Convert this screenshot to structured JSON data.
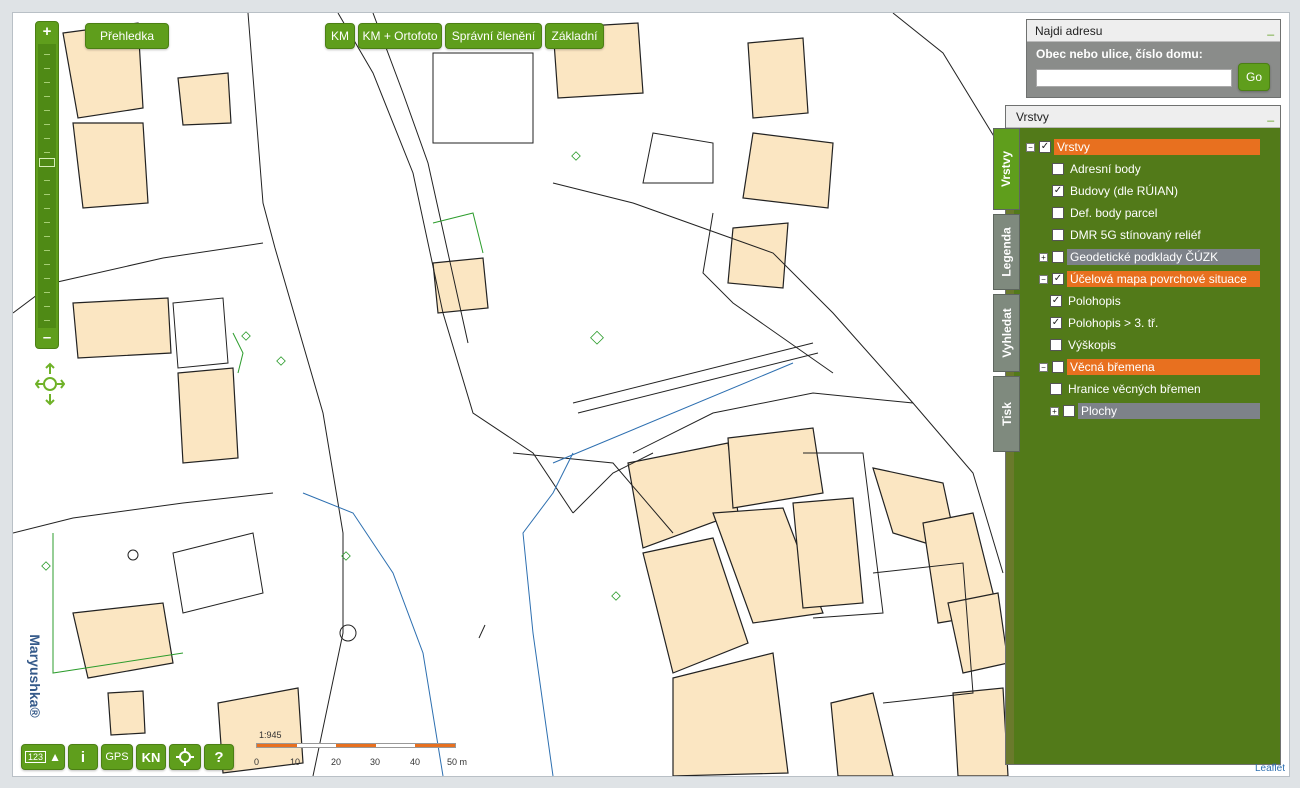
{
  "top_buttons": {
    "overview": "Přehledka",
    "km": "KM",
    "km_ortofoto": "KM + Ortofoto",
    "spravni": "Správní členění",
    "zakladni": "Základní"
  },
  "zoom": {
    "in": "+",
    "out": "–"
  },
  "brand": "Maryushka®",
  "bottom_buttons": {
    "measure": "123",
    "info": "i",
    "gps": "GPS",
    "kn": "KN",
    "help": "?"
  },
  "scale": {
    "ratio": "1:945",
    "ticks": [
      "0",
      "10",
      "20",
      "30",
      "40",
      "50 m"
    ]
  },
  "search": {
    "title": "Najdi adresu",
    "label": "Obec nebo ulice, číslo domu:",
    "value": "",
    "go": "Go"
  },
  "layers": {
    "title": "Vrstvy",
    "tabs": [
      "Vrstvy",
      "Legenda",
      "Vyhledat",
      "Tisk"
    ],
    "items": [
      {
        "label": "Vrstvy",
        "checked": true,
        "expander": "minus",
        "level": 0,
        "style": "orange"
      },
      {
        "label": "Adresní body",
        "checked": false,
        "expander": "",
        "level": 1,
        "style": ""
      },
      {
        "label": "Budovy (dle RÚIAN)",
        "checked": true,
        "expander": "",
        "level": 1,
        "style": ""
      },
      {
        "label": "Def. body parcel",
        "checked": false,
        "expander": "",
        "level": 1,
        "style": ""
      },
      {
        "label": "DMR 5G stínovaný reliéf",
        "checked": false,
        "expander": "",
        "level": 1,
        "style": ""
      },
      {
        "label": "Geodetické podklady ČÚZK",
        "checked": false,
        "expander": "plus",
        "level": 1,
        "style": "grey"
      },
      {
        "label": "Účelová mapa povrchové situace",
        "checked": true,
        "expander": "minus",
        "level": 1,
        "style": "orange"
      },
      {
        "label": "Polohopis",
        "checked": true,
        "expander": "",
        "level": 2,
        "style": ""
      },
      {
        "label": "Polohopis > 3. tř.",
        "checked": true,
        "expander": "",
        "level": 2,
        "style": ""
      },
      {
        "label": "Výškopis",
        "checked": false,
        "expander": "",
        "level": 2,
        "style": ""
      },
      {
        "label": "Věcná břemena",
        "checked": false,
        "expander": "minus",
        "level": 1,
        "style": "orange"
      },
      {
        "label": "Hranice věcných břemen",
        "checked": false,
        "expander": "",
        "level": 2,
        "style": ""
      },
      {
        "label": "Plochy",
        "checked": false,
        "expander": "plus",
        "level": 2,
        "style": "grey"
      }
    ]
  },
  "attribution": "Leaflet",
  "colors": {
    "accent": "#5f9e1c",
    "highlight": "#e8701f",
    "building": "#fbe6c2"
  }
}
